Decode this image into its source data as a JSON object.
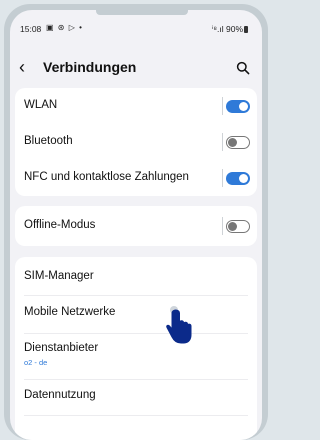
{
  "status_bar": {
    "time": "15:08",
    "icons": "▣ ⊛ ▷ •",
    "right": "ⁱ⁸.ıl 90%"
  },
  "header": {
    "back_icon": "‹",
    "title": "Verbindungen"
  },
  "card1": {
    "items": [
      {
        "label": "WLAN",
        "toggle": "on"
      },
      {
        "label": "Bluetooth",
        "toggle": "off"
      },
      {
        "label": "NFC und kontaktlose Zahlungen",
        "toggle": "on"
      }
    ]
  },
  "card2": {
    "items": [
      {
        "label": "Offline-Modus",
        "toggle": "off"
      }
    ]
  },
  "card3": {
    "items": [
      {
        "label": "SIM-Manager"
      },
      {
        "label": "Mobile Netzwerke"
      },
      {
        "label": "Dienstanbieter",
        "sub": "o2 - de"
      },
      {
        "label": "Datennutzung"
      }
    ]
  },
  "colors": {
    "accent": "#2f7ad8",
    "background": "#f2f2f6"
  }
}
